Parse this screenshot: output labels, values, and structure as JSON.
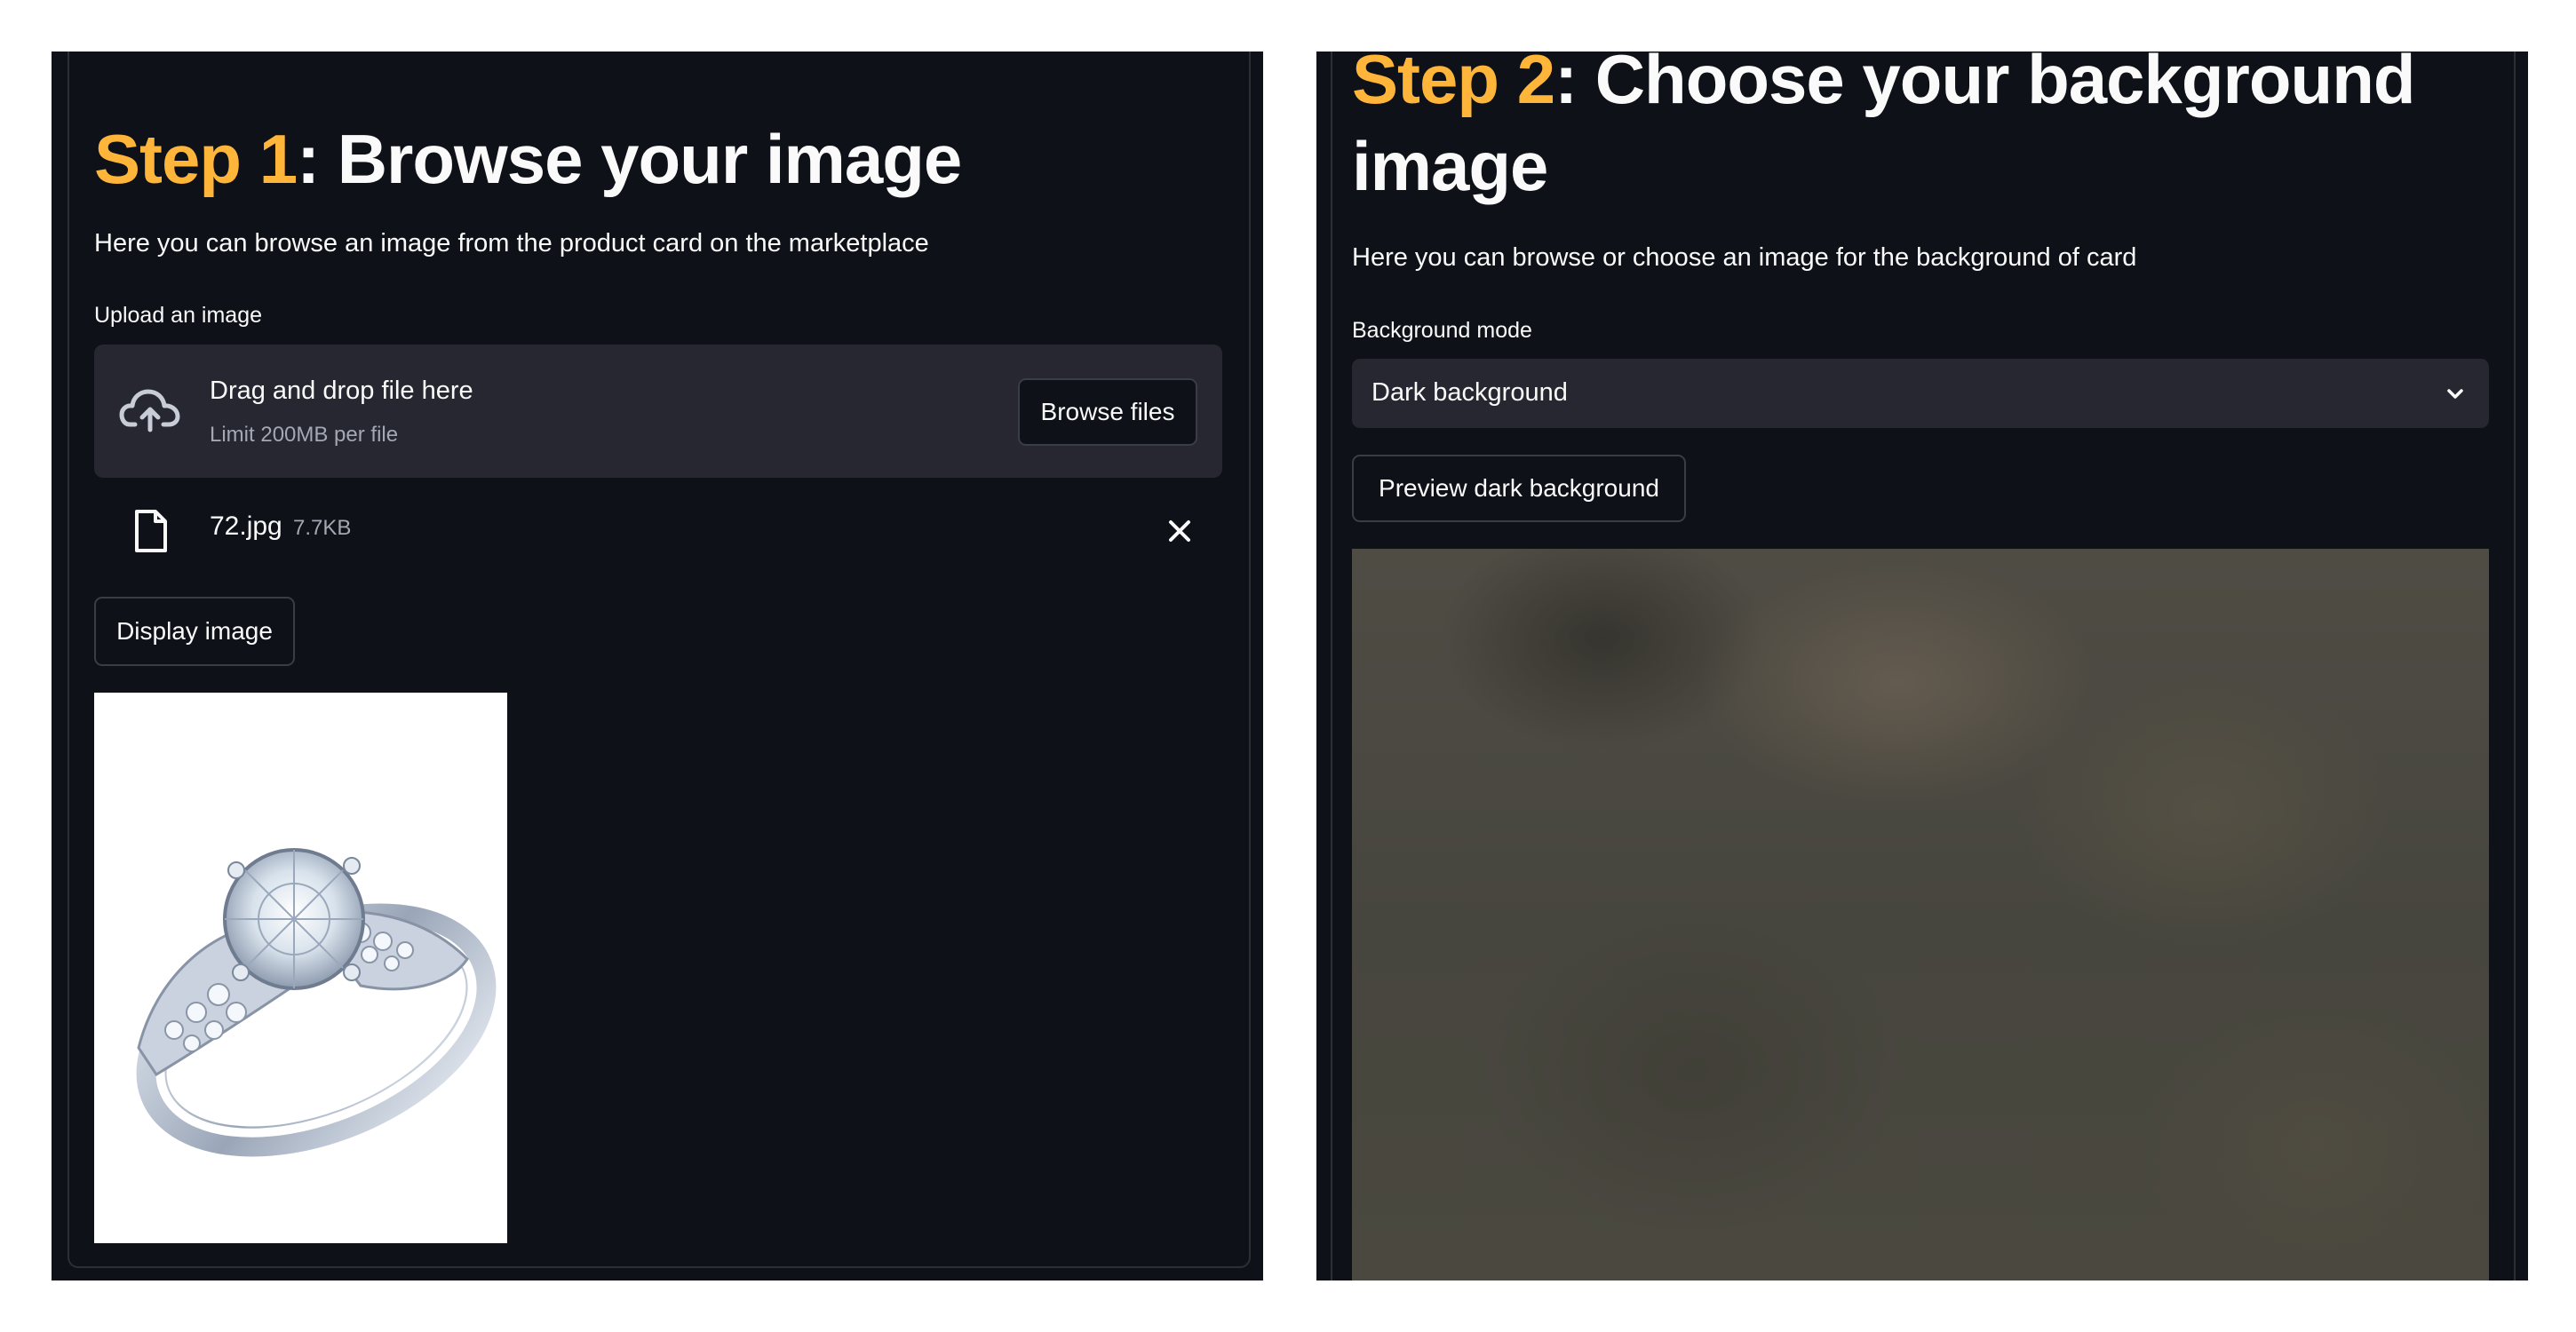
{
  "step1": {
    "title_step": "Step 1",
    "title_rest": ": Browse your image",
    "description": "Here you can browse an image from the product card on the marketplace",
    "upload_label": "Upload an image",
    "dropzone_title": "Drag and drop file here",
    "dropzone_limit": "Limit 200MB per file",
    "browse_button": "Browse files",
    "file_name": "72.jpg",
    "file_size": "7.7KB",
    "display_button": "Display image",
    "image_subject": "silver ring with diamond"
  },
  "step2": {
    "title_step": "Step 2",
    "title_rest_line1": ": Choose your background",
    "title_line2": "image",
    "description": "Here you can browse or choose an image for the background of card",
    "mode_label": "Background mode",
    "mode_value": "Dark background",
    "preview_button": "Preview dark background"
  },
  "colors": {
    "accent": "#ffb43a",
    "panel_bg": "#0e1117",
    "widget_bg": "#262730"
  }
}
